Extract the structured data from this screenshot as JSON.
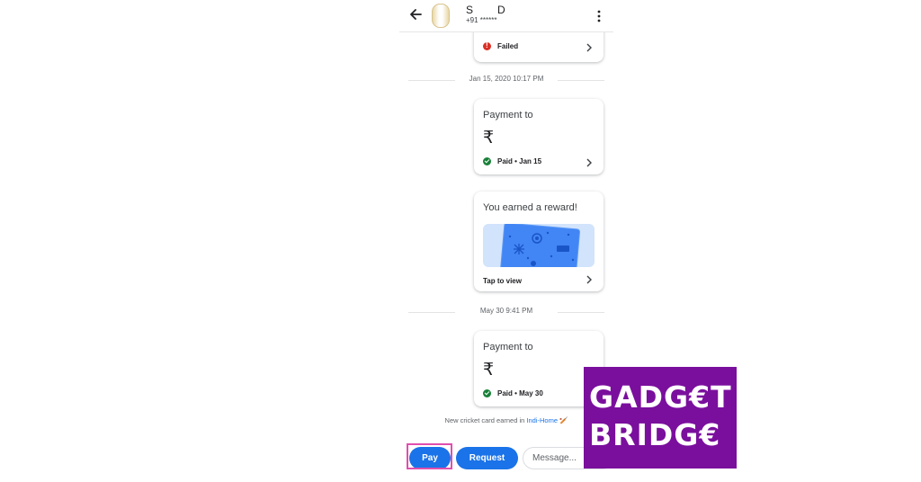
{
  "header": {
    "contact_name": "S      D",
    "contact_phone": "+91 ******"
  },
  "messages": [
    {
      "type": "status_card",
      "status": "Failed",
      "status_color": "#d93025"
    },
    {
      "type": "date",
      "text": "Jan 15, 2020 10:17 PM"
    },
    {
      "type": "payment_card",
      "title": "Payment to",
      "currency": "₹",
      "status": "Paid • Jan 15",
      "status_color": "#188038"
    },
    {
      "type": "reward_card",
      "title": "You earned a reward!",
      "action": "Tap to view"
    },
    {
      "type": "date",
      "text": "May 30 9:41 PM"
    },
    {
      "type": "payment_card",
      "title": "Payment to",
      "currency": "₹",
      "status": "Paid • May 30",
      "status_color": "#188038"
    }
  ],
  "earned_note": {
    "prefix": "New cricket card earned in ",
    "link": "Indi-Home",
    "emoji": "🏏"
  },
  "composer": {
    "pay_label": "Pay",
    "request_label": "Request",
    "message_placeholder": "Message..."
  },
  "logo": {
    "line1": "GADG€T",
    "line2": "BRIDG€",
    "background": "#7a0f9d"
  },
  "colors": {
    "accent": "#1a73e8",
    "highlight": "#e04fae"
  }
}
